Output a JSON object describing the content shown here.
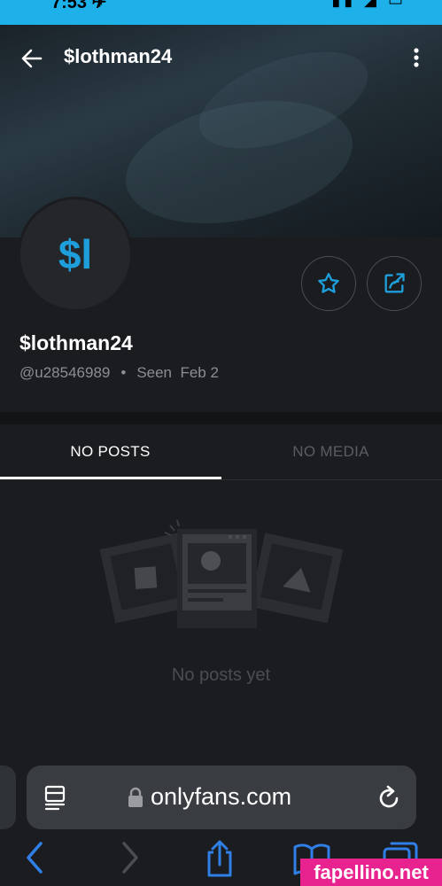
{
  "status_bar": {
    "time": "7:53 ✈",
    "icons": "▮▮ ◢ ▭"
  },
  "header": {
    "title": "$lothman24"
  },
  "profile": {
    "avatar_initials": "$l",
    "name": "$lothman24",
    "handle": "@u28546989",
    "separator": "•",
    "seen": "Seen  Feb 2"
  },
  "tabs": [
    {
      "label": "NO POSTS",
      "active": true
    },
    {
      "label": "NO MEDIA",
      "active": false
    }
  ],
  "empty_state": {
    "text": "No posts yet"
  },
  "browser": {
    "url": "onlyfans.com"
  },
  "watermark": "fapellino.net",
  "colors": {
    "accent": "#1e9fdc",
    "status_bar": "#1db0e9",
    "background": "#1b1c1f",
    "watermark": "#e8238f"
  },
  "icons": [
    "back-arrow-icon",
    "more-vert-icon",
    "star-icon",
    "share-icon",
    "reader-icon",
    "lock-icon",
    "reload-icon",
    "chevron-left-icon",
    "chevron-right-icon",
    "share-upload-icon",
    "book-icon",
    "tabs-icon"
  ]
}
